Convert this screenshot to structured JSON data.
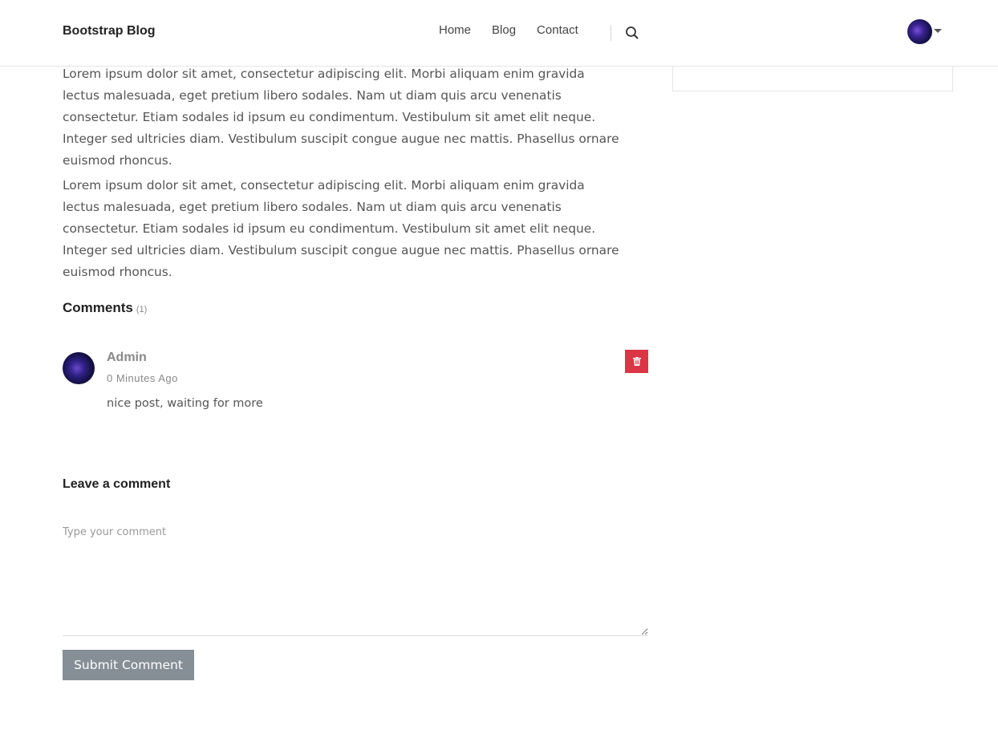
{
  "header": {
    "brand": "Bootstrap Blog",
    "nav": [
      {
        "label": "Home"
      },
      {
        "label": "Blog"
      },
      {
        "label": "Contact"
      }
    ],
    "search_icon": "search-icon",
    "user_avatar_icon": "avatar-icon",
    "dropdown_icon": "caret-down-icon"
  },
  "post": {
    "paragraphs": [
      "Lorem ipsum dolor sit amet, consectetur adipiscing elit. Morbi aliquam enim gravida lectus malesuada, eget pretium libero sodales. Nam ut diam quis arcu venenatis consectetur. Etiam sodales id ipsum eu condimentum. Vestibulum sit amet elit neque. Integer sed ultricies diam. Vestibulum suscipit congue augue nec mattis. Phasellus ornare euismod rhoncus.",
      "Lorem ipsum dolor sit amet, consectetur adipiscing elit. Morbi aliquam enim gravida lectus malesuada, eget pretium libero sodales. Nam ut diam quis arcu venenatis consectetur. Etiam sodales id ipsum eu condimentum. Vestibulum sit amet elit neque. Integer sed ultricies diam. Vestibulum suscipit congue augue nec mattis. Phasellus ornare euismod rhoncus."
    ]
  },
  "comments": {
    "heading": "Comments",
    "count": "(1)",
    "items": [
      {
        "author": "Admin",
        "time": "0 Minutes Ago",
        "text": "nice post, waiting for more",
        "delete_icon": "trash-icon"
      }
    ]
  },
  "leave_comment": {
    "heading": "Leave a comment",
    "placeholder": "Type your comment",
    "value": "",
    "submit_label": "Submit Comment"
  },
  "colors": {
    "delete_button": "#dc3545",
    "submit_button": "#868e96"
  }
}
